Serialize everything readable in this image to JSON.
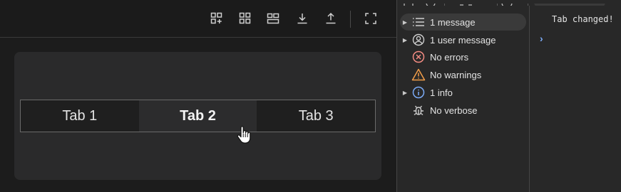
{
  "tabs": [
    {
      "label": "Tab 1",
      "active": false
    },
    {
      "label": "Tab 2",
      "active": true
    },
    {
      "label": "Tab 3",
      "active": false
    }
  ],
  "toolbar": {
    "icons": [
      "add-widget-icon",
      "grid-icon",
      "layout-icon",
      "download-icon",
      "upload-icon",
      "fullscreen-icon"
    ]
  },
  "console": {
    "sidebar": [
      {
        "label": "1 message",
        "icon": "list-icon",
        "expandable": true,
        "selected": true
      },
      {
        "label": "1 user message",
        "icon": "user-icon",
        "expandable": true,
        "selected": false
      },
      {
        "label": "No errors",
        "icon": "error-icon",
        "expandable": false,
        "selected": false
      },
      {
        "label": "No warnings",
        "icon": "warning-icon",
        "expandable": false,
        "selected": false
      },
      {
        "label": "1 info",
        "icon": "info-icon",
        "expandable": true,
        "selected": false
      },
      {
        "label": "No verbose",
        "icon": "bug-icon",
        "expandable": false,
        "selected": false
      }
    ],
    "message": "Tab changed!",
    "prompt": "›"
  },
  "colors": {
    "error": "#f28b82",
    "warning": "#f29d49",
    "info": "#7cacf8",
    "prompt": "#7cacf8"
  }
}
